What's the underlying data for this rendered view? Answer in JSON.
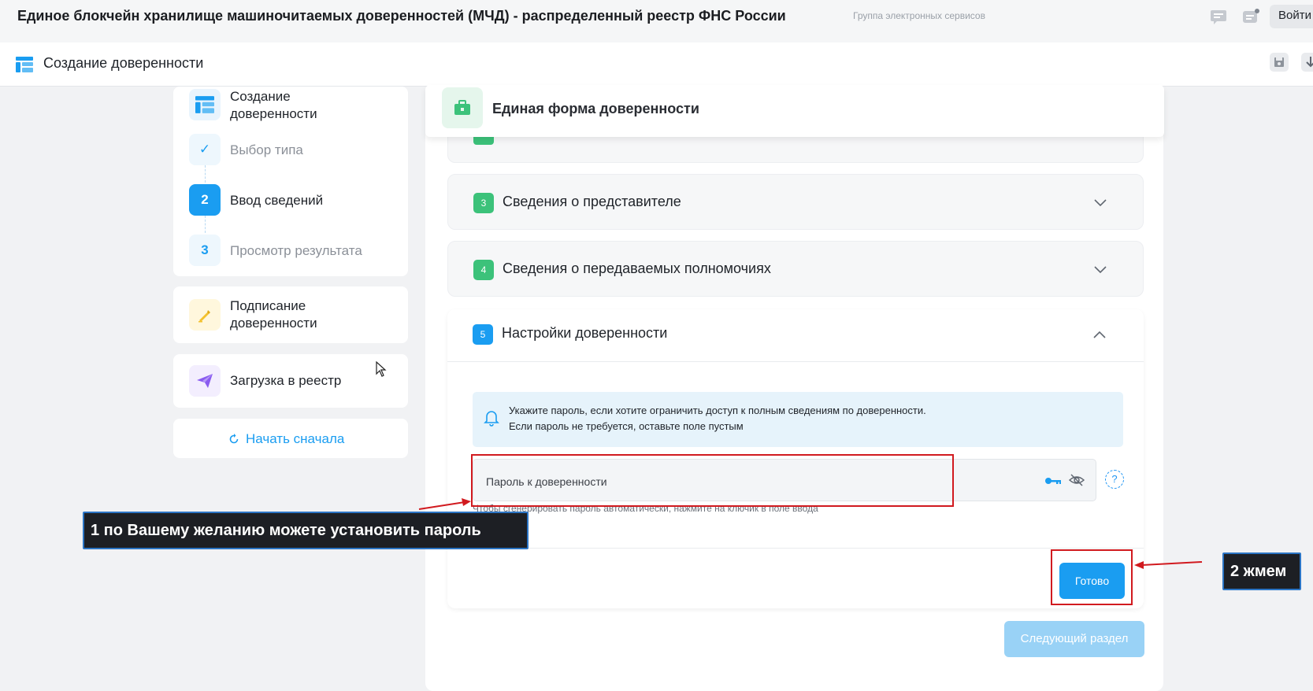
{
  "header": {
    "title": "Единое блокчейн хранилище машиночитаемых доверенностей (МЧД) - распределенный реестр ФНС России",
    "subtitle": "Группа электронных сервисов",
    "login_label": "Войти"
  },
  "subheader": {
    "title": "Создание доверенности"
  },
  "sidebar": {
    "create_title": "Создание доверенности",
    "create_line1": "Создание",
    "create_line2": "доверенности",
    "steps": [
      {
        "marker": "✓",
        "label": "Выбор типа"
      },
      {
        "marker": "2",
        "label": "Ввод сведений"
      },
      {
        "marker": "3",
        "label": "Просмотр результата"
      }
    ],
    "sign_line1": "Подписание",
    "sign_line2": "доверенности",
    "upload_label": "Загрузка в реестр",
    "restart_label": "Начать сначала"
  },
  "form": {
    "header_title": "Единая форма доверенности",
    "sections": [
      {
        "number": "3",
        "title": "Сведения о представителе"
      },
      {
        "number": "4",
        "title": "Сведения о передаваемых полномочиях"
      },
      {
        "number": "5",
        "title": "Настройки доверенности"
      }
    ],
    "info_line1": "Укажите пароль, если хотите ограничить доступ к полным сведениям по доверенности.",
    "info_line2": "Если пароль не требуется, оставьте поле пустым",
    "password_label": "Пароль к доверенности",
    "password_hint": "Чтобы сгенерировать пароль автоматически, нажмите на ключик в поле ввода",
    "help_label": "?",
    "ready_label": "Готово",
    "next_label": "Следующий раздел"
  },
  "annotations": {
    "note1": "1 по Вашему желанию можете установить пароль",
    "note2": "2 жмем"
  },
  "colors": {
    "accent": "#1a9df1",
    "success": "#3cc27a",
    "highlight": "#d11a1f"
  }
}
